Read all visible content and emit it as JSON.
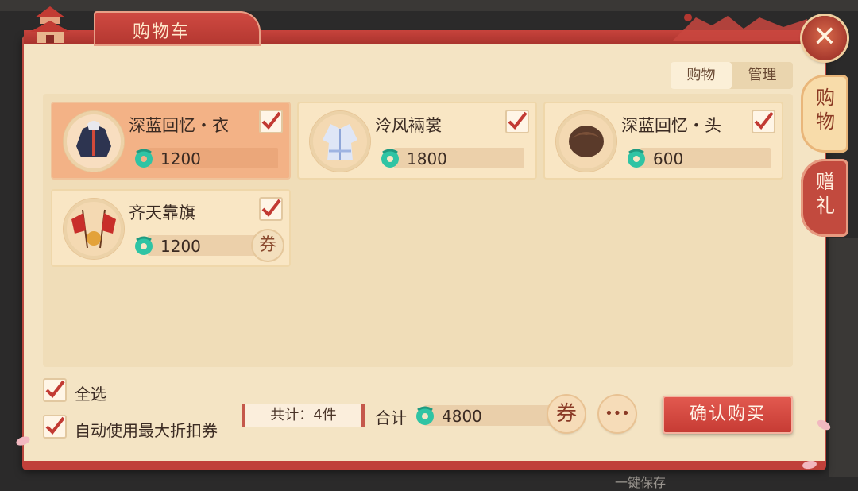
{
  "dialog": {
    "title": "购物车",
    "close_glyph": "✕"
  },
  "mode_toggle": {
    "items": [
      {
        "label": "购物",
        "active": true
      },
      {
        "label": "管理",
        "active": false
      }
    ]
  },
  "side_tabs": [
    {
      "label": "购物",
      "active": true
    },
    {
      "label": "赠礼",
      "active": false
    }
  ],
  "cart_items": [
    {
      "name": "深蓝回忆・衣",
      "price": "1200",
      "checked": true,
      "selected": true,
      "icon": "jacket-icon",
      "has_coupon": false
    },
    {
      "name": "泠风裲裳",
      "price": "1800",
      "checked": true,
      "selected": false,
      "icon": "robe-icon",
      "has_coupon": false
    },
    {
      "name": "深蓝回忆・头",
      "price": "600",
      "checked": true,
      "selected": false,
      "icon": "hair-icon",
      "has_coupon": false
    },
    {
      "name": "齐天靠旗",
      "price": "1200",
      "checked": true,
      "selected": false,
      "icon": "flag-icon",
      "has_coupon": true,
      "coupon_label": "券"
    }
  ],
  "footer": {
    "select_all_label": "全选",
    "select_all_checked": true,
    "auto_coupon_label": "自动使用最大折扣券",
    "auto_coupon_checked": true,
    "count_text": "共计：4件",
    "total_label": "合计",
    "total_value": "4800",
    "coupon_label": "券",
    "more_label": "•••",
    "confirm_label": "确认购买"
  },
  "background": {
    "save_text": "一键保存"
  },
  "colors": {
    "accent_red": "#c5403a",
    "panel": "#f4e4c4",
    "selected_card": "#f3b286",
    "jade": "#2fc4a4"
  }
}
